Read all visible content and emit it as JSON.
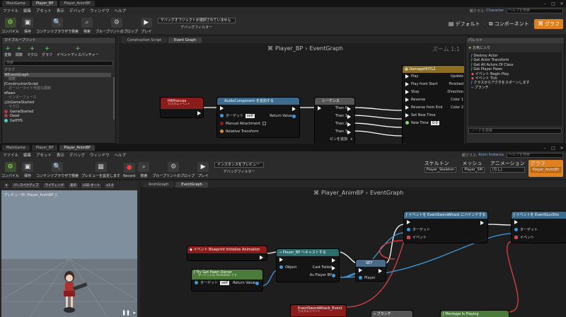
{
  "top_window": {
    "file_tabs": [
      "MainGame",
      "Player_BP",
      "Player_AnimBP"
    ],
    "menu": [
      "ファイル",
      "編集",
      "アセット",
      "表示",
      "デバッグ",
      "ウィンドウ",
      "ヘルプ"
    ],
    "parent_class_label": "親クラス:",
    "parent_class_value": "Character",
    "search_placeholder": "ヘルプを検索",
    "toolbar": [
      {
        "label": "コンパイル"
      },
      {
        "label": "保存"
      },
      {
        "label": "コンテンツブラウザで検索"
      },
      {
        "label": "検索"
      },
      {
        "label": "ブループリントのプロップ"
      },
      {
        "label": "プレイ"
      }
    ],
    "debug_filter": {
      "value": "デバッグオブジェクトが選択されていません",
      "label": "デバッグフィルター"
    },
    "modes": [
      "デフォルト",
      "コンポーネント",
      "グラフ"
    ],
    "my_blueprint": {
      "title": "マイブループリント",
      "buttons": [
        "変数",
        "関数",
        "マクロ",
        "グラフ",
        "イベントディスパッチャー"
      ],
      "search_placeholder": "検索",
      "section_graph": "グラフ",
      "event_graph": "EventGraph",
      "event_graph_sub": "関数",
      "construction_script": "ConstructionScript",
      "construction_sub": "オーバーライド可能な関数",
      "section_pawn": "Pawn",
      "pawn_sub": "インターフェース",
      "is_game_started": "IsGameStarted",
      "is_game_started_sub": "マクロ",
      "vars": [
        "GameStarted",
        "Dead",
        "GetFPS"
      ]
    },
    "graph_tabs": [
      "Construction Script",
      "Event Graph"
    ],
    "breadcrumb": [
      "Player_BP",
      "EventGraph"
    ],
    "zoom": "ズーム 1:1",
    "nodes": {
      "hit_process": {
        "title": "HitProcces",
        "sub": "カスタムイベント"
      },
      "audio": {
        "title": "AudioComponent を追加する",
        "target": "ターゲット",
        "self": "self",
        "return": "Return Value",
        "manual": "Manual Attachment",
        "relative": "Relative Transform"
      },
      "sequence": {
        "title": "シーケンス",
        "then": [
          "Then 0",
          "Then 1",
          "Then 2",
          "Then 3"
        ],
        "add": "ピンを追加"
      },
      "timeline": {
        "title": "DamageHitTL2",
        "inputs": [
          "Play",
          "Play from Start",
          "Stop",
          "Reverse",
          "Reverse from End",
          "Set New Time",
          "New Time"
        ],
        "new_time_val": "0.0",
        "outputs": [
          "Update",
          "Finished",
          "Direction",
          "Color 1",
          "Color 2"
        ]
      }
    },
    "palette": {
      "title": "パレット",
      "favorites": "お気に入り",
      "items": [
        "Destroy Actor",
        "Get Actor Transform",
        "Get All Actors Of Class",
        "Get Player Pawn",
        "イベント Begin Play",
        "イベント Tick",
        "クラスからアクタをスポーンします",
        "ブランチ"
      ],
      "search_placeholder": "ノードを検索"
    }
  },
  "bottom_window": {
    "file_tabs": [
      "MainGame",
      "Player_BP",
      "Player_AnimBP"
    ],
    "menu": [
      "ファイル",
      "編集",
      "アセット",
      "表示",
      "デバッグ",
      "ウィンドウ",
      "ヘルプ"
    ],
    "parent_class_label": "親クラス:",
    "parent_class_value": "Anim Instance",
    "search_placeholder": "ヘルプを検索",
    "toolbar": [
      {
        "label": "コンパイル"
      },
      {
        "label": "保存"
      },
      {
        "label": "コンテンツブラウザで検索"
      },
      {
        "label": "プレビューを設定します"
      },
      {
        "label": "Record"
      },
      {
        "label": "検索"
      },
      {
        "label": "ブループリントのプロップ"
      },
      {
        "label": "プレイ"
      }
    ],
    "debug_filter": {
      "value": "インスタンスをプレビュー",
      "label": "デバッグフィルター"
    },
    "modes": [
      {
        "title": "スケルトン",
        "value": "Player_Skeleton"
      },
      {
        "title": "メッシュ",
        "value": "Player_SM"
      },
      {
        "title": "アニメーション",
        "value": "(なし)"
      },
      {
        "title": "グラフ",
        "value": "Player_AnimBP"
      }
    ],
    "viewport": {
      "buttons": [
        "パースペクティブ",
        "ライティング",
        "表示",
        "LOD オート",
        "x1.0"
      ],
      "preview_label": "プレビュー中: Player_AnimBP_C"
    },
    "graph_tabs": [
      "AnimGraph",
      "EventGraph"
    ],
    "breadcrumb": [
      "Player_AnimBP",
      "EventGraph"
    ],
    "nodes": {
      "init_event": {
        "title": "イベント Blueprint Initialize Animation"
      },
      "try_get_pawn": {
        "title": "Try Get Pawn Owner",
        "sub": "ターゲットは Animation です",
        "target": "ターゲット",
        "self": "self",
        "return": "Return Value"
      },
      "cast": {
        "title": "Player_BP へキャストする",
        "object": "Object",
        "failed": "Cast Failed",
        "as": "As Player BP"
      },
      "set": {
        "title": "SET",
        "player": "Player"
      },
      "bind1": {
        "title": "イベントを EventSwordAttack にバインドする",
        "target": "ターゲット",
        "event": "イベント"
      },
      "bind2": {
        "title": "イベントを EventGunSho",
        "target": "ターゲット",
        "event": "イベント"
      },
      "sword_event": {
        "title": "EventSwordAttack_Event",
        "sub": "カスタムイベント"
      },
      "branch": {
        "title": "ブランチ"
      },
      "montage": {
        "title": "Montage Is Playing"
      }
    }
  }
}
